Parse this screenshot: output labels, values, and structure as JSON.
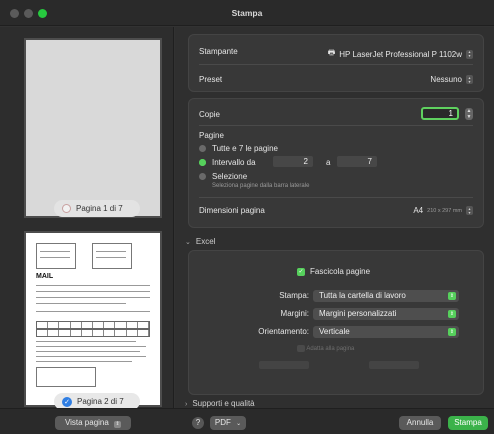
{
  "window": {
    "title": "Stampa"
  },
  "preview": {
    "page1_label": "Pagina 1 di 7",
    "page2_label": "Pagina 2 di 7",
    "doc_heading": "MAIL"
  },
  "printer": {
    "label": "Stampante",
    "value": "HP LaserJet Professional P 1102w",
    "preset_label": "Preset",
    "preset_value": "Nessuno"
  },
  "copies": {
    "label": "Copie",
    "value": "1"
  },
  "pages": {
    "label": "Pagine",
    "all_label": "Tutte e 7 le pagine",
    "range_label": "Intervallo da",
    "range_from": "2",
    "range_to_label": "a",
    "range_to": "7",
    "selection_label": "Selezione",
    "selection_hint": "Seleziona pagine dalla barra laterale"
  },
  "paper": {
    "label": "Dimensioni pagina",
    "value": "A4",
    "detail": "210 x 297 mm"
  },
  "excel": {
    "section_label": "Excel",
    "collate_label": "Fascicola pagine",
    "print_label": "Stampa:",
    "print_value": "Tutta la cartella di lavoro",
    "margins_label": "Margini:",
    "margins_value": "Margini personalizzati",
    "orientation_label": "Orientamento:",
    "orientation_value": "Verticale",
    "fit_label": "Adatta alla pagina"
  },
  "quality": {
    "section_label": "Supporti e qualità"
  },
  "footer": {
    "preview_button": "Vista pagina",
    "help": "?",
    "pdf_button": "PDF",
    "cancel_button": "Annulla",
    "print_button": "Stampa"
  },
  "colors": {
    "accent_green": "#56d05c",
    "primary_button": "#3bb24a",
    "focus_blue": "#2f7ee3"
  }
}
